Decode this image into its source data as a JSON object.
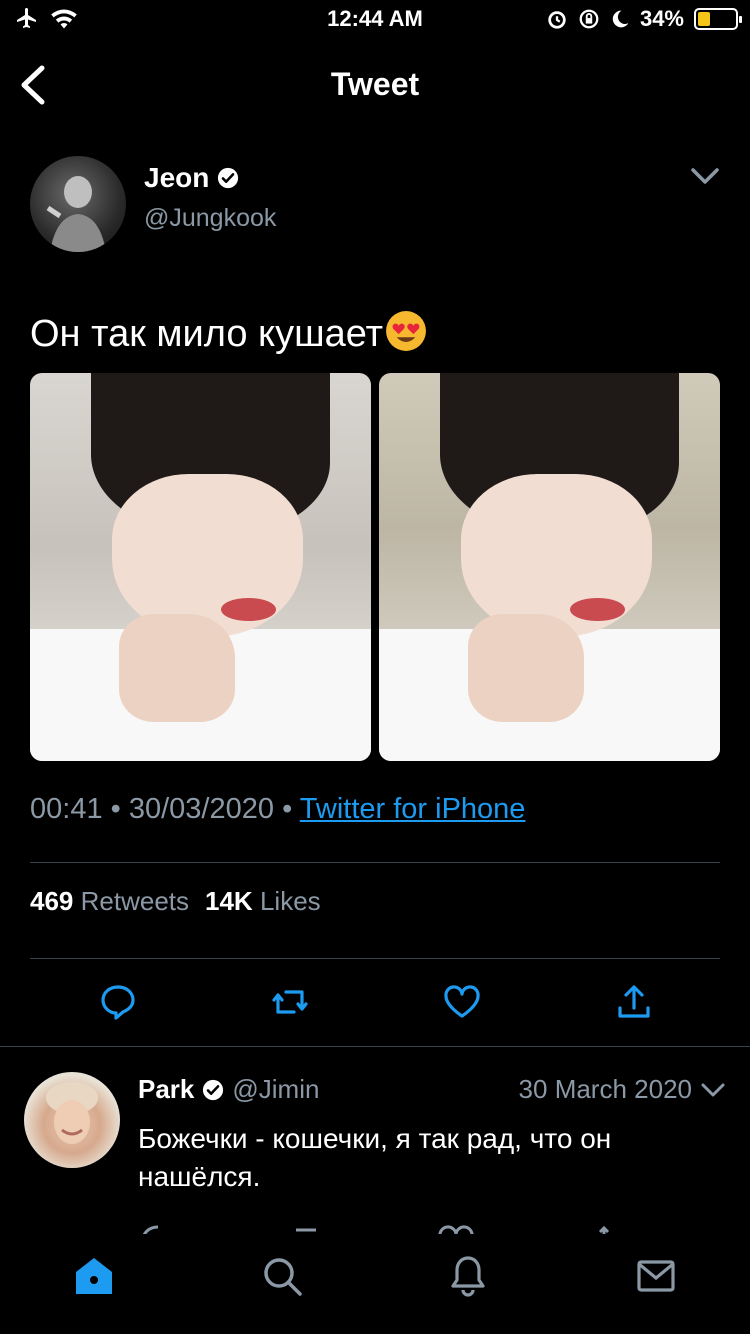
{
  "status_bar": {
    "time": "12:44 AM",
    "battery_pct": "34%",
    "icons": [
      "airplane-icon",
      "wifi-icon",
      "alarm-icon",
      "orientation-lock-icon",
      "moon-icon",
      "battery-icon"
    ],
    "battery_color": "#f5c518"
  },
  "nav": {
    "title": "Tweet",
    "back_icon": "chevron-left-icon"
  },
  "tweet": {
    "author_name": "Jeon",
    "author_handle": "@Jungkook",
    "text": "Он так мило кушает",
    "emoji": "heart-eyes-emoji",
    "time": "00:41",
    "date": "30/03/2020",
    "source": "Twitter for iPhone",
    "retweets_count": "469",
    "retweets_label": "Retweets",
    "likes_count": "14K",
    "likes_label": "Likes",
    "media_count": 2
  },
  "reply": {
    "author_name": "Park",
    "author_handle": "@Jimin",
    "date": "30 March 2020",
    "text": "Божечки - кошечки, я так рад, что он нашёлся."
  },
  "tab_bar": {
    "items": [
      "home-icon",
      "search-icon",
      "notifications-icon",
      "messages-icon"
    ],
    "active": "home-icon",
    "active_color": "#1d9bf0"
  },
  "colors": {
    "background": "#000000",
    "secondary_text": "#8b98a5",
    "accent": "#1d9bf0",
    "divider": "#38444d"
  }
}
